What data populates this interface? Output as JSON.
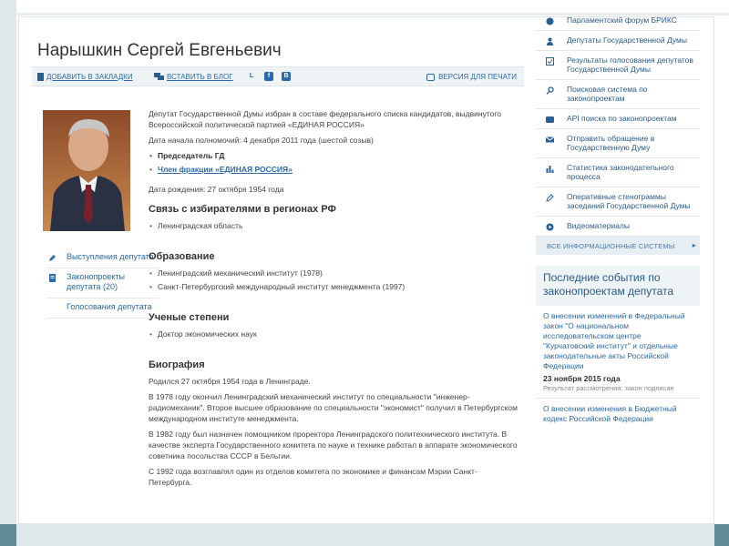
{
  "deputy": {
    "name": "Нарышкин Сергей Евгеньевич"
  },
  "toolbar": {
    "bookmark": "ДОБАВИТЬ В ЗАКЛАДКИ",
    "blog": "ВСТАВИТЬ В БЛОГ",
    "social": [
      "L",
      "f",
      "B"
    ],
    "print": "ВЕРСИЯ ДЛЯ ПЕЧАТИ"
  },
  "sidebar": {
    "items": [
      {
        "label": "Выступления депутата",
        "icon": "pen-icon"
      },
      {
        "label": "Законопроекты депутата (20)",
        "icon": "document-icon"
      },
      {
        "label": "Голосования депутата",
        "icon": ""
      }
    ]
  },
  "content": {
    "intro": "Депутат Государственной Думы избран в составе федерального списка кандидатов, выдвинутого Всероссийской политической партией «ЕДИНАЯ РОССИЯ»",
    "term_start": "Дата начала полномочий: 4 декабря 2011 года (шестой созыв)",
    "position": "Председатель ГД",
    "faction": "Член фракции «ЕДИНАЯ РОССИЯ»",
    "birth_date": "Дата рождения: 27 октября 1954 года",
    "regions_heading": "Связь с избирателями в регионах РФ",
    "regions": [
      "Ленинградская область"
    ],
    "education_heading": "Образование",
    "education": [
      "Ленинградский механический институт (1978)",
      "Санкт-Петербургский международный институт менеджмента (1997)"
    ],
    "degrees_heading": "Ученые степени",
    "degrees": [
      "Доктор экономических наук"
    ],
    "bio_heading": "Биография",
    "bio": [
      "Родился 27 октября 1954 года в Ленинграде.",
      "В 1978 году окончил Ленинградский механический институт по специальности \"инженер-радиомеханик\". Второе высшее образование по специальности \"экономист\" получил в Петербургском международном институте менеджмента.",
      "В 1982 году был назначен помощником проректора Ленинградского политехнического института. В качестве эксперта Государственного комитета по науке и технике работал в аппарате экономического советника посольства СССР в Бельгии.",
      "С 1992 года возглавлял один из отделов комитета по экономике и финансам Мэрии Санкт-Петербурга."
    ]
  },
  "right_nav": {
    "items": [
      {
        "label": "Парламентский форум БРИКС",
        "icon": "globe-icon"
      },
      {
        "label": "Депутаты Государственной Думы",
        "icon": "person-icon"
      },
      {
        "label": "Результаты голосования депутатов Государственной Думы",
        "icon": "ballot-icon"
      },
      {
        "label": "Поисковая система по законопроектам",
        "icon": "search-icon"
      },
      {
        "label": "API поиска по законопроектам",
        "icon": "api-icon"
      },
      {
        "label": "Отправить обращение в Государственную Думу",
        "icon": "mail-icon"
      },
      {
        "label": "Статистика законодательного процесса",
        "icon": "stats-icon"
      },
      {
        "label": "Оперативные стенограммы заседаний Государственной Думы",
        "icon": "pen-icon"
      },
      {
        "label": "Видеоматериалы",
        "icon": "video-icon"
      }
    ],
    "all_systems": "ВСЕ ИНФОРМАЦИОННЫЕ СИСТЕМЫ"
  },
  "events": {
    "heading": "Последние события по законопроектам депутата",
    "items": [
      {
        "title": "О внесении изменений в Федеральный закон \"О национальном исследовательском центре \"Курчатовский институт\" и отдельные законодательные акты Российской Федерации",
        "date": "23 ноября 2015 года",
        "status": "Результат рассмотрения: закон подписан"
      },
      {
        "title": "О внесении изменения в Бюджетный кодекс Российской Федерации",
        "date": "",
        "status": ""
      }
    ]
  },
  "colors": {
    "link": "#2a6aa8",
    "toolbar_bg": "#eef3f6",
    "frame": "#5f8b96"
  }
}
